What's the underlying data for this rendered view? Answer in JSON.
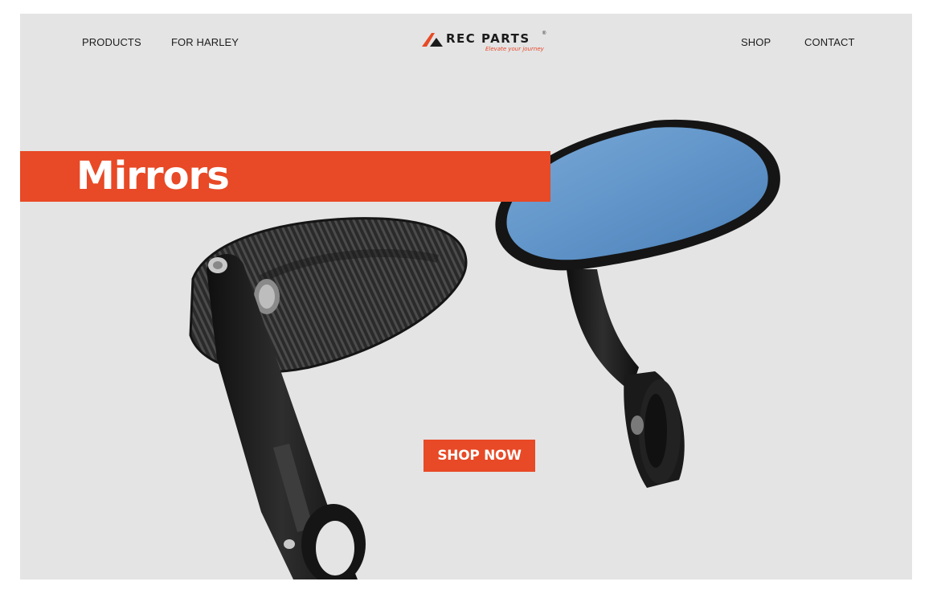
{
  "nav": {
    "left_links": [
      "PRODUCTS",
      "FOR HARLEY"
    ],
    "right_links": [
      "SHOP",
      "CONTACT"
    ]
  },
  "logo": {
    "wordmark": "REC PARTS",
    "registered": "®",
    "tagline": "Elevate your journey",
    "icon": "rec-parts-arrow-logo-icon"
  },
  "hero": {
    "title": "Mirrors",
    "cta_label": "SHOP NOW",
    "images": [
      "black-bar-end-mirror-rear-view",
      "blue-glass-bar-end-mirror-front-view"
    ]
  },
  "colors": {
    "accent": "#e84926",
    "hero_background": "#e4e4e4",
    "nav_text": "#1d1d1d",
    "mirror_glass": "#5f93c8",
    "mirror_body": "#1a1a1a"
  }
}
